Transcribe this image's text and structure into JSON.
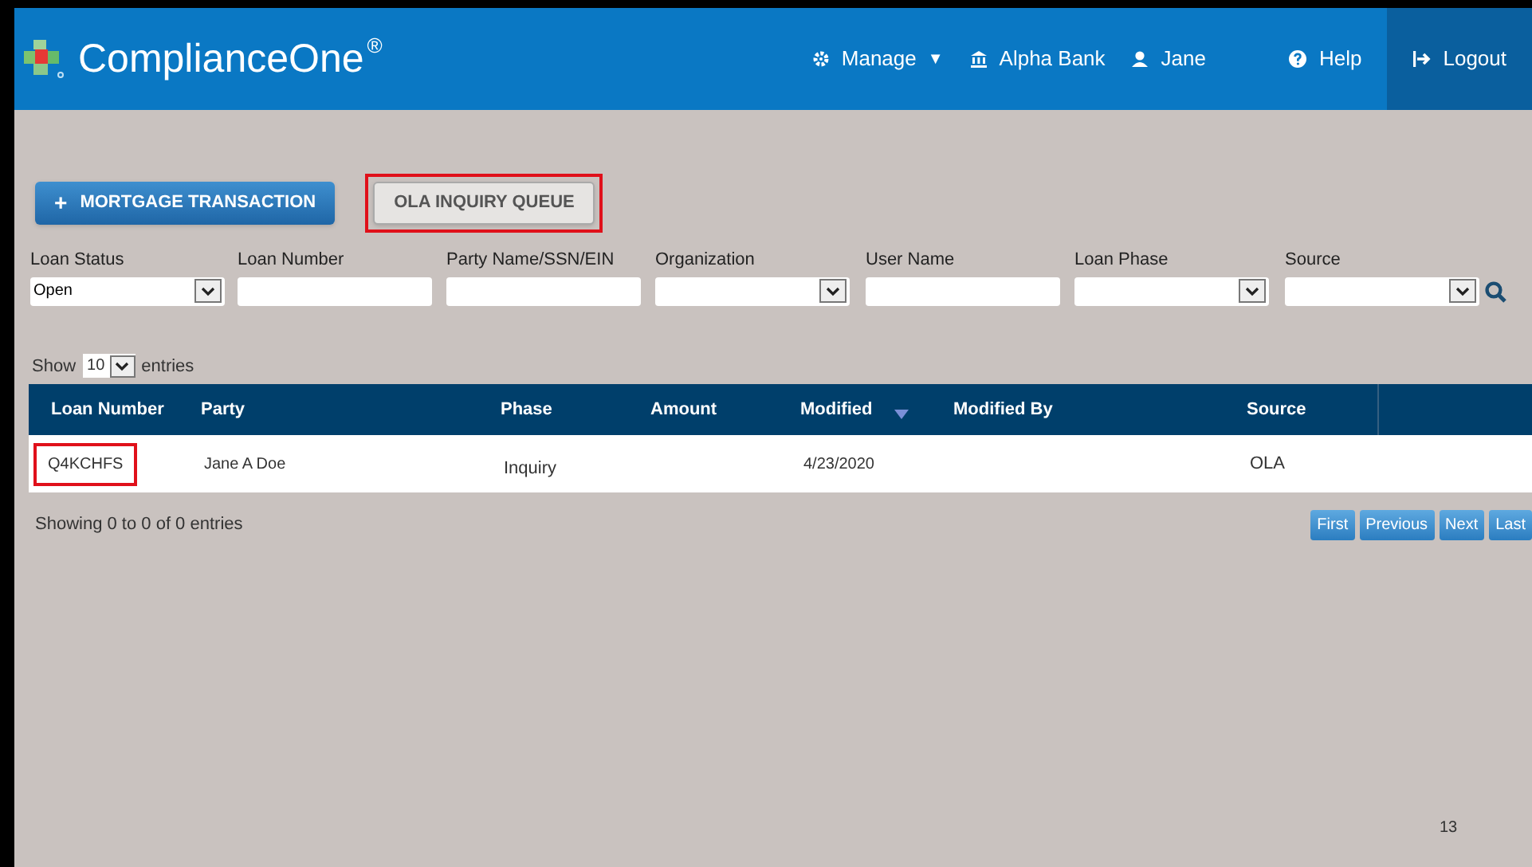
{
  "header": {
    "logo_text": "ComplianceOne",
    "logo_mark": "®",
    "nav": [
      {
        "kind": "manage",
        "label": "Manage",
        "caret": "▼"
      },
      {
        "kind": "bank",
        "label": "Alpha Bank"
      },
      {
        "kind": "user",
        "label": "Jane"
      },
      {
        "kind": "help",
        "label": "Help"
      },
      {
        "kind": "logout",
        "label": "Logout"
      }
    ]
  },
  "actions": [
    {
      "kind": "primary",
      "icon": "+",
      "label": "MORTGAGE TRANSACTION",
      "highlighted": false
    },
    {
      "kind": "secondary",
      "label": "OLA INQUIRY QUEUE",
      "highlighted": true
    }
  ],
  "filters": [
    {
      "kind": "select",
      "label": "Loan Status",
      "value": "Open"
    },
    {
      "kind": "text",
      "label": "Loan Number"
    },
    {
      "kind": "text",
      "label": "Party Name/SSN/EIN"
    },
    {
      "kind": "select",
      "label": "Organization"
    },
    {
      "kind": "text",
      "label": "User Name"
    },
    {
      "kind": "select",
      "label": "Loan Phase"
    },
    {
      "kind": "select",
      "label": "Source"
    }
  ],
  "length_menu": {
    "before": "Show",
    "value": "10",
    "after": "entries"
  },
  "table": {
    "columns": [
      {
        "label": "Loan Number",
        "sorted": false
      },
      {
        "label": "Party",
        "sorted": false
      },
      {
        "label": "Phase",
        "sorted": false
      },
      {
        "label": "Amount",
        "sorted": false
      },
      {
        "label": "Modified",
        "sorted": true
      },
      {
        "label": "Modified By",
        "sorted": false
      },
      {
        "label": "Source",
        "sorted": false
      },
      {
        "sorted": false
      }
    ],
    "rows": [
      {
        "cells": [
          {
            "text": "Q4KCHFS",
            "highlighted": true
          },
          {
            "text": "Jane A Doe",
            "highlighted": false
          },
          {
            "text": "Inquiry",
            "highlighted": false
          },
          {
            "highlighted": false
          },
          {
            "text": "4/23/2020",
            "highlighted": false
          },
          {
            "highlighted": false
          },
          {
            "text": "OLA",
            "highlighted": false
          },
          {
            "highlighted": false
          }
        ]
      }
    ]
  },
  "info": "Showing 0 to 0 of 0 entries",
  "pagination": [
    "First",
    "Previous",
    "Next",
    "Last"
  ],
  "page_number": "13"
}
